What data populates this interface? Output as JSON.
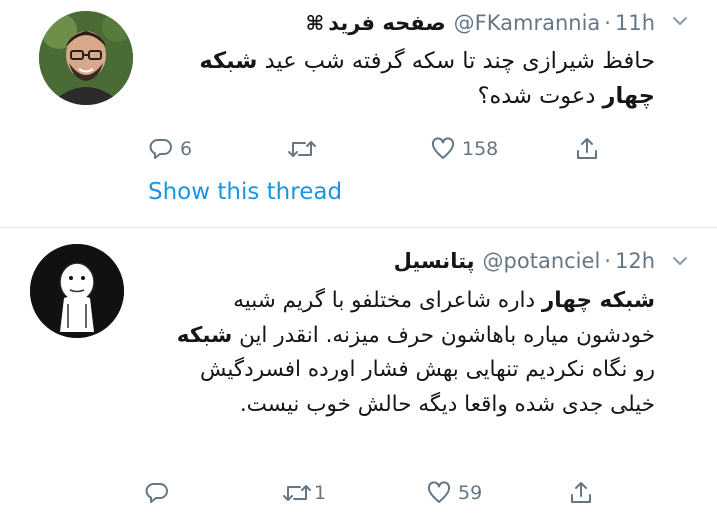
{
  "tweets": [
    {
      "name": "صفحه فرید",
      "name_emoji": "⌘",
      "handle": "@FKamrannia",
      "time": "11h",
      "text_parts": [
        {
          "t": "حافظ شیرازی چند تا سکه گرفته شب عید ",
          "b": false
        },
        {
          "t": "شبکه چهار",
          "b": true
        },
        {
          "t": " دعوت شده؟",
          "b": false
        }
      ],
      "replies": "6",
      "retweets": "",
      "likes": "158",
      "thread_link": "Show this thread"
    },
    {
      "name": "پتانسیل",
      "handle": "@potanciel",
      "time": "12h",
      "text_parts": [
        {
          "t": "شبکه چهار",
          "b": true
        },
        {
          "t": " داره شاعرای مختلفو با گریم شبیه خودشون میاره باهاشون حرف میزنه. انقدر این ",
          "b": false
        },
        {
          "t": "شبکه",
          "b": true
        },
        {
          "t": " رو نگاه نکردیم تنهایی بهش فشار اورده افسردگیش خیلی جدی شده واقعا دیگه حالش خوب نیست.",
          "b": false
        }
      ],
      "replies": "",
      "retweets": "1",
      "likes": "59"
    }
  ],
  "icons": {
    "reply": "reply-icon",
    "retweet": "retweet-icon",
    "like": "heart-icon",
    "share": "share-icon",
    "caret": "chevron-down-icon"
  },
  "colors": {
    "link": "#1b95e0",
    "muted": "#657786",
    "text": "#14171a",
    "divider": "#e1e8ed"
  }
}
